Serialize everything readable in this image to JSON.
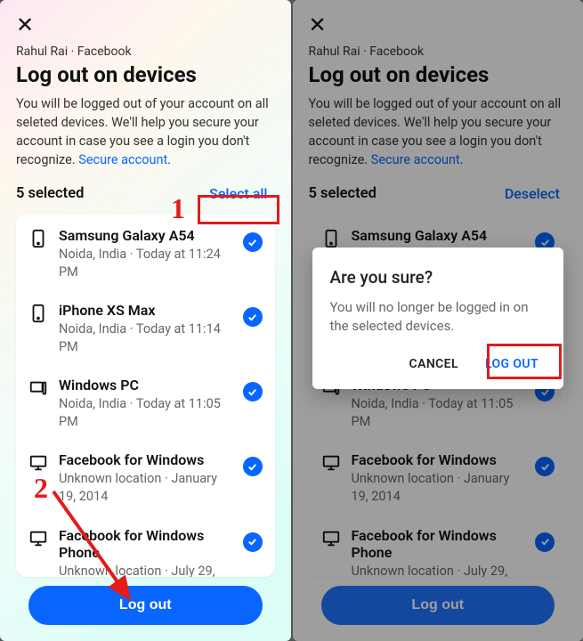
{
  "breadcrumb": "Rahul Rai · Facebook",
  "title": "Log out on devices",
  "description_pre": "You will be logged out of your account on all seleted devices. We'll help you secure your account in case you see a login you don't recognize. ",
  "secure_link": "Secure account",
  "description_post": ".",
  "left": {
    "selected_label": "5  selected",
    "select_action": "Select all"
  },
  "right": {
    "selected_label": "5  selected",
    "select_action": "Deselect"
  },
  "devices": [
    {
      "name": "Samsung Galaxy A54",
      "detail": "Noida, India · Today at 11:24 PM",
      "icon": "phone"
    },
    {
      "name": "iPhone XS Max",
      "detail": "Noida, India · Today at 11:14 PM",
      "icon": "phone"
    },
    {
      "name": "Windows PC",
      "detail": "Noida, India · Today at 11:05 PM",
      "icon": "pc"
    },
    {
      "name": "Facebook for Windows",
      "detail": "Unknown location · January 19, 2014",
      "icon": "monitor"
    },
    {
      "name": "Facebook for Windows Phone",
      "detail": "Unknown location · July 29,",
      "icon": "monitor"
    }
  ],
  "logout_label": "Log out",
  "dialog": {
    "title": "Are you sure?",
    "message": "You will no longer be logged in on the selected devices.",
    "cancel": "CANCEL",
    "confirm": "LOG OUT"
  },
  "annotations": {
    "num1": "1",
    "num2": "2"
  }
}
